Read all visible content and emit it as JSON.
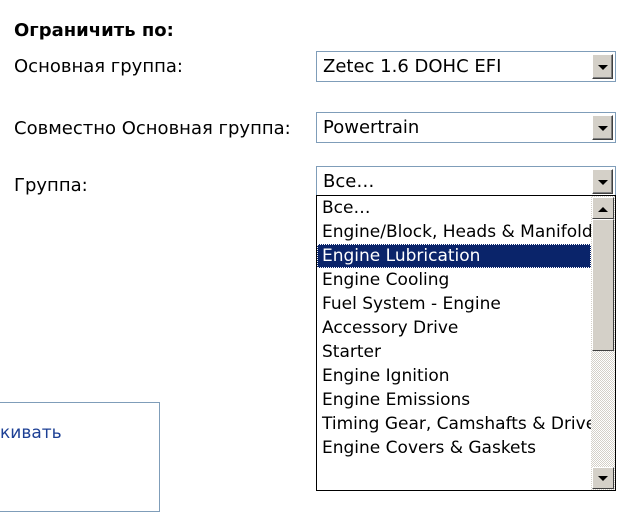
{
  "filter": {
    "heading": "Ограничить по:",
    "rows": [
      {
        "label": "Основная группа:",
        "value": "Zetec 1.6 DOHC EFI"
      },
      {
        "label": "Совместно Основная группа:",
        "value": "Powertrain"
      },
      {
        "label": "Группа:",
        "value": "Все…"
      }
    ]
  },
  "dropdown": {
    "options": [
      "Все…",
      "Engine/Block, Heads & Manifolds",
      "Engine Lubrication",
      "Engine Cooling",
      "Fuel System - Engine",
      "Accessory Drive",
      "Starter",
      "Engine Ignition",
      "Engine Emissions",
      "Timing Gear, Camshafts & Drive",
      "Engine Covers & Gaskets"
    ],
    "highlighted": "Engine Lubrication"
  },
  "background": {
    "partial_link_text": "кивать"
  },
  "icons": {
    "dropdown": "chevron-down-icon",
    "scroll_up": "scroll-up-icon",
    "scroll_down": "scroll-down-icon"
  },
  "colors": {
    "selection": "#0a246a",
    "border": "#7f9db9",
    "button_face": "#d4d0c8"
  }
}
